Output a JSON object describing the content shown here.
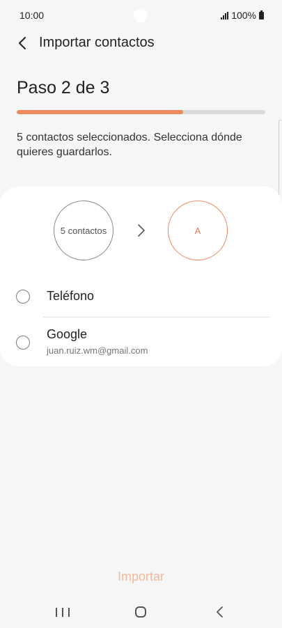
{
  "status_bar": {
    "time": "10:00",
    "battery": "100%"
  },
  "header": {
    "back_icon": "chevron-left-icon",
    "title": "Importar contactos"
  },
  "step": {
    "title": "Paso 2 de 3",
    "progress_percent": 67,
    "accent_color": "#ef8a5e"
  },
  "description": "5 contactos seleccionados. Selecciona dónde quieres guardarlos.",
  "transfer": {
    "source_label": "5 contactos",
    "target_label": "A",
    "arrow_icon": "chevron-right-icon"
  },
  "options": [
    {
      "label": "Teléfono",
      "selected": false
    },
    {
      "label": "Google",
      "sublabel": "juan.ruiz.wm@gmail.com",
      "selected": false
    }
  ],
  "actions": {
    "import_label": "Importar"
  },
  "nav_bar": {
    "recent_icon": "recent-apps-icon",
    "home_icon": "home-icon",
    "back_icon": "back-icon"
  }
}
